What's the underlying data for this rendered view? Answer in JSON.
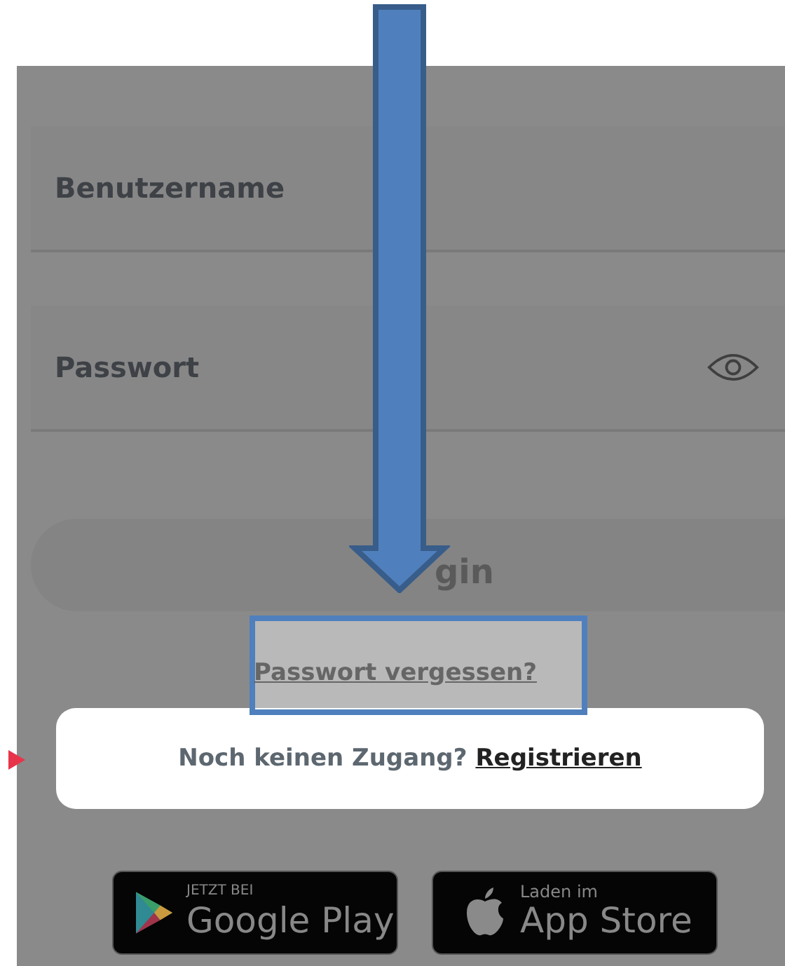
{
  "fields": [
    {
      "kind": "text",
      "label": "Benutzername"
    },
    {
      "kind": "password",
      "label": "Passwort"
    }
  ],
  "login_button": {
    "label": "gin"
  },
  "forgot_link": "Passwort vergessen?",
  "register_card": {
    "prompt": "Noch keinen Zugang?",
    "link": "Registrieren"
  },
  "store_badges": [
    {
      "kind": "google",
      "small": "JETZT BEI",
      "big": "Google Play"
    },
    {
      "kind": "apple",
      "small": "Laden im",
      "big": "App Store"
    }
  ]
}
